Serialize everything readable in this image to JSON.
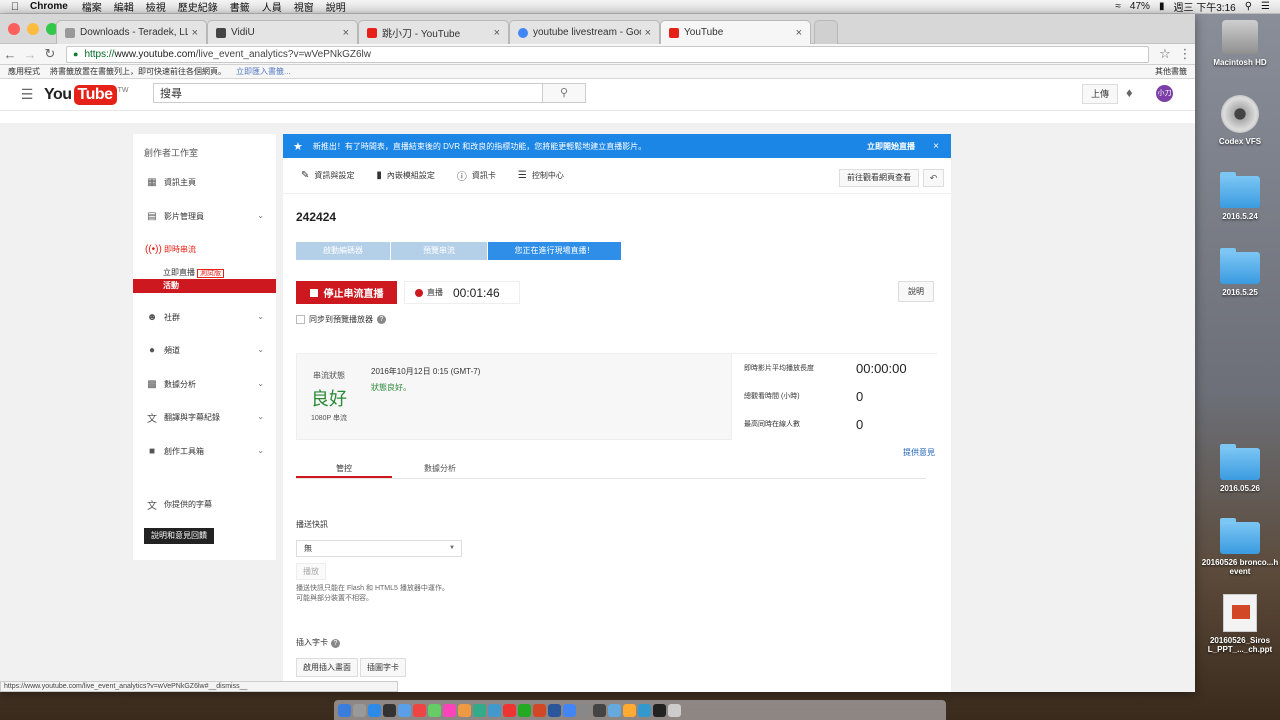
{
  "menubar": {
    "app": "Chrome",
    "items": [
      "檔案",
      "編輯",
      "檢視",
      "歷史紀錄",
      "書籤",
      "人員",
      "視窗",
      "說明"
    ],
    "battery": "47%",
    "clock": "週三 下午3:16"
  },
  "tabs": [
    {
      "label": "Downloads - Teradek, LLC",
      "color": "#999999"
    },
    {
      "label": "VidiU",
      "color": "#444444"
    },
    {
      "label": "跳小刀 - YouTube",
      "color": "#e62117"
    },
    {
      "label": "youtube livestream - Google",
      "color": "#4285f4"
    },
    {
      "label": "YouTube",
      "color": "#e62117"
    }
  ],
  "address": {
    "scheme": "https://",
    "host": "www.youtube.com",
    "path": "/live_event_analytics?v=wVePNkGZ6lw"
  },
  "bookmarks": {
    "apps": "應用程式",
    "hint": "將書籤放置在書籤列上，即可快速前往各個網頁。",
    "import": "立即匯入書籤...",
    "other": "其他書籤"
  },
  "masthead": {
    "logo_you": "You",
    "logo_tube": "Tube",
    "logo_tw": "TW",
    "search_placeholder": "搜尋",
    "upload": "上傳",
    "avatar": "小刀"
  },
  "sidebar": {
    "title": "創作者工作室",
    "items": [
      {
        "label": "資訊主頁"
      },
      {
        "label": "影片管理員"
      },
      {
        "label": "即時串流"
      },
      {
        "label": "社群"
      },
      {
        "label": "頻道"
      },
      {
        "label": "數據分析"
      },
      {
        "label": "翻譯與字幕紀錄"
      },
      {
        "label": "創作工具箱"
      },
      {
        "label": "你提供的字幕"
      }
    ],
    "sub_stream_now": "立即直播",
    "sub_beta": "測試版",
    "sub_events": "活動",
    "help": "說明和意見回饋"
  },
  "banner": {
    "text": "新推出！有了時間表，直播結束後的 DVR 和改良的指標功能，您將能更輕鬆地建立直播影片。",
    "action": "立即開始直播"
  },
  "toolbar": {
    "info": "資訊與設定",
    "cards": "內嵌模組設定",
    "infocard": "資訊卡",
    "control": "控制中心",
    "view": "前往觀看網頁查看"
  },
  "event": {
    "title": "242424",
    "steps": [
      "啟動編碼器",
      "預覽串流",
      "您正在進行現場直播！"
    ],
    "stop": "停止串流直播",
    "live_label": "直播",
    "elapsed": "00:01:46",
    "description_btn": "說明",
    "sync": "同步到預覽播放器"
  },
  "stats": {
    "state_label": "串流狀態",
    "state": "良好",
    "resolution": "1080P 串流",
    "datetime": "2016年10月12日 0:15 (GMT-7)",
    "health": "狀態良好。",
    "metrics": [
      {
        "label": "即時影片平均播放長度",
        "value": "00:00:00"
      },
      {
        "label": "總觀看時間 (小時)",
        "value": "0"
      },
      {
        "label": "最高同時在線人數",
        "value": "0"
      }
    ],
    "feedback": "提供意見"
  },
  "subtabs": [
    "管控",
    "數據分析"
  ],
  "slate": {
    "heading": "播送快訊",
    "select": "無",
    "play": "播放",
    "note1": "播送快訊只能在 Flash 和 HTML5 播放器中運作。",
    "note2": "可能與部分裝置不相容。"
  },
  "cards": {
    "heading": "插入字卡",
    "use_btn": "啟用插入畫面",
    "insert_btn": "插圖字卡"
  },
  "statusbar": "https://www.youtube.com/live_event_analytics?v=wVePNkGZ6lw#__dismiss__",
  "desktop": [
    {
      "label": "Macintosh HD",
      "type": "drive"
    },
    {
      "label": "Codex VFS",
      "type": "disc"
    },
    {
      "label": "2016.5.24",
      "type": "folder"
    },
    {
      "label": "2016.5.25",
      "type": "folder"
    },
    {
      "label": "2016.05.26",
      "type": "folder"
    },
    {
      "label": "20160526 bronco...h event",
      "type": "folder"
    },
    {
      "label": "20160526_Siros L_PPT_..._ch.ppt",
      "type": "ppt"
    }
  ]
}
